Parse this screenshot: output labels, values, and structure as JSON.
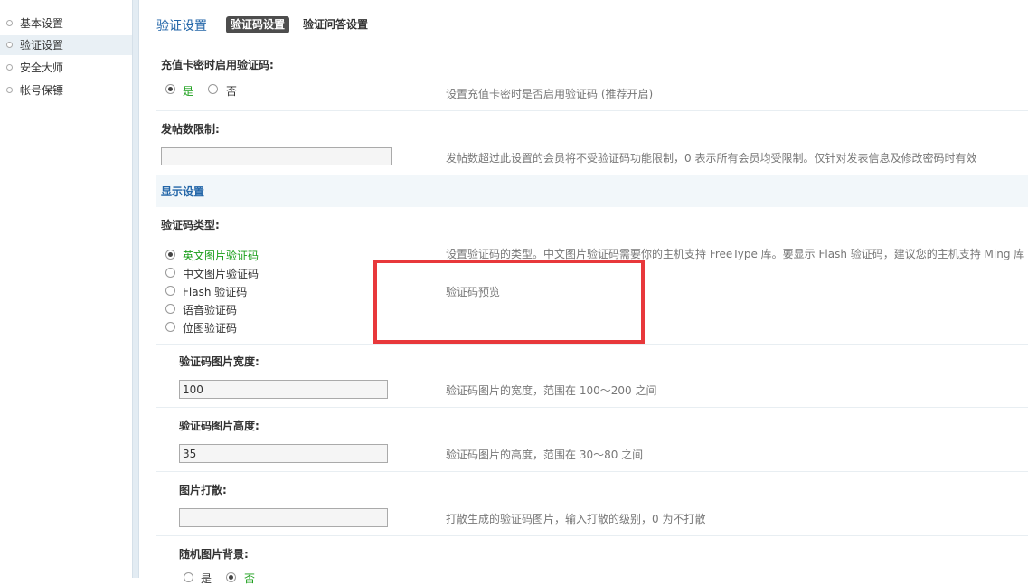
{
  "sidebar": {
    "items": [
      {
        "label": "基本设置"
      },
      {
        "label": "验证设置"
      },
      {
        "label": "安全大师"
      },
      {
        "label": "帐号保镖"
      }
    ]
  },
  "header": {
    "title": "验证设置",
    "tabs": [
      {
        "label": "验证码设置"
      },
      {
        "label": "验证问答设置"
      }
    ]
  },
  "recharge": {
    "label": "充值卡密时启用验证码:",
    "yes": "是",
    "no": "否",
    "tip": "设置充值卡密时是否启用验证码 (推荐开启)"
  },
  "postlimit": {
    "label": "发帖数限制:",
    "value": "",
    "tip": "发帖数超过此设置的会员将不受验证码功能限制，0 表示所有会员均受限制。仅针对发表信息及修改密码时有效"
  },
  "display_section": {
    "title": "显示设置"
  },
  "captcha_type": {
    "label": "验证码类型:",
    "options": [
      {
        "label": "英文图片验证码"
      },
      {
        "label": "中文图片验证码"
      },
      {
        "label": "Flash 验证码"
      },
      {
        "label": "语音验证码"
      },
      {
        "label": "位图验证码"
      }
    ],
    "tip": "设置验证码的类型。中文图片验证码需要你的主机支持 FreeType 库。要显示 Flash 验证码，建议您的主机支持 Ming 库",
    "preview": "验证码预览"
  },
  "width": {
    "label": "验证码图片宽度:",
    "value": "100",
    "tip": "验证码图片的宽度，范围在 100～200 之间"
  },
  "height": {
    "label": "验证码图片高度:",
    "value": "35",
    "tip": "验证码图片的高度，范围在 30～80 之间"
  },
  "scatter": {
    "label": "图片打散:",
    "value": "",
    "tip": "打散生成的验证码图片，输入打散的级别，0 为不打散"
  },
  "random_bg": {
    "label": "随机图片背景:",
    "yes": "是",
    "no": "否"
  },
  "colors": {
    "accent": "#2366a8",
    "highlight_box": "#e8383b",
    "green_selected": "#1a9e1a"
  }
}
